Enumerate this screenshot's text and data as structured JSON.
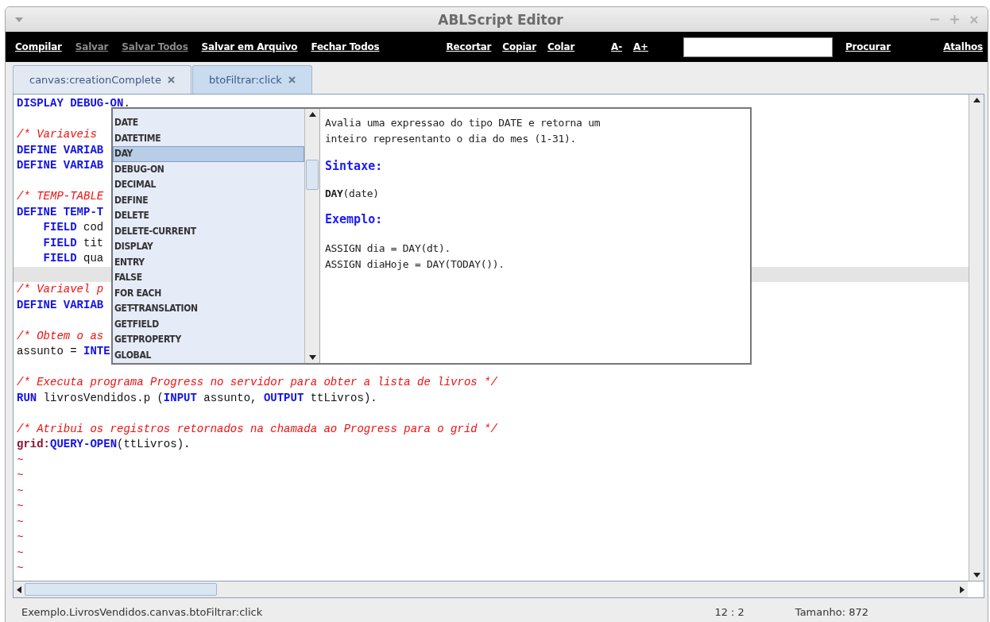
{
  "window": {
    "title": "ABLScript Editor"
  },
  "toolbar": {
    "groups": [
      [
        {
          "label": "Compilar",
          "disabled": false
        },
        {
          "label": "Salvar",
          "disabled": true
        },
        {
          "label": "Salvar Todos",
          "disabled": true
        },
        {
          "label": "Salvar em Arquivo",
          "disabled": false
        },
        {
          "label": "Fechar Todos",
          "disabled": false
        }
      ],
      [
        {
          "label": "Recortar",
          "disabled": false
        },
        {
          "label": "Copiar",
          "disabled": false
        },
        {
          "label": "Colar",
          "disabled": false
        }
      ],
      [
        {
          "label": "A-",
          "disabled": false
        },
        {
          "label": "A+",
          "disabled": false
        }
      ]
    ],
    "search_button": "Procurar",
    "shortcuts_button": "Atalhos"
  },
  "tabs": [
    {
      "label": "canvas:creationComplete",
      "selected": false
    },
    {
      "label": "btoFiltrar:click",
      "selected": true
    }
  ],
  "editor": {
    "lines": [
      {
        "current": false,
        "tokens": [
          {
            "kind": "keyword",
            "text": "DISPLAY DEBUG-ON"
          },
          {
            "kind": "plain",
            "text": "."
          }
        ]
      },
      {
        "current": false
      },
      {
        "current": false,
        "tokens": [
          {
            "kind": "comment",
            "text": "/* Variaveis"
          }
        ]
      },
      {
        "current": false,
        "tokens": [
          {
            "kind": "keyword",
            "text": "DEFINE VARIAB"
          }
        ]
      },
      {
        "current": false,
        "tokens": [
          {
            "kind": "keyword",
            "text": "DEFINE VARIAB"
          }
        ]
      },
      {
        "current": false
      },
      {
        "current": false,
        "tokens": [
          {
            "kind": "comment",
            "text": "/* TEMP-TABLE"
          }
        ]
      },
      {
        "current": false,
        "tokens": [
          {
            "kind": "keyword",
            "text": "DEFINE TEMP-T"
          }
        ]
      },
      {
        "current": false,
        "indented": true,
        "tokens": [
          {
            "kind": "keyword",
            "text": "FIELD"
          },
          {
            "kind": "plain",
            "text": " cod"
          }
        ]
      },
      {
        "current": false,
        "indented": true,
        "tokens": [
          {
            "kind": "keyword",
            "text": "FIELD"
          },
          {
            "kind": "plain",
            "text": " tit"
          }
        ]
      },
      {
        "current": false,
        "indented": true,
        "tokens": [
          {
            "kind": "keyword",
            "text": "FIELD"
          },
          {
            "kind": "plain",
            "text": " qua"
          }
        ]
      },
      {
        "current": true
      },
      {
        "current": false,
        "tokens": [
          {
            "kind": "comment",
            "text": "/* Variavel p"
          }
        ]
      },
      {
        "current": false,
        "tokens": [
          {
            "kind": "keyword",
            "text": "DEFINE VARIAB"
          }
        ]
      },
      {
        "current": false
      },
      {
        "current": false,
        "tokens": [
          {
            "kind": "comment",
            "text": "/* Obtem o as"
          }
        ]
      },
      {
        "current": false,
        "tokens": [
          {
            "kind": "plain",
            "text": "assunto = "
          },
          {
            "kind": "keyword",
            "text": "INTE"
          }
        ]
      },
      {
        "current": false
      },
      {
        "current": false,
        "tokens": [
          {
            "kind": "comment",
            "text": "/* Executa programa Progress no servidor para obter a lista de livros */"
          }
        ]
      },
      {
        "current": false,
        "tokens": [
          {
            "kind": "keyword",
            "text": "RUN"
          },
          {
            "kind": "plain",
            "text": " livrosVendidos.p ("
          },
          {
            "kind": "keyword",
            "text": "INPUT"
          },
          {
            "kind": "plain",
            "text": " assunto, "
          },
          {
            "kind": "keyword",
            "text": "OUTPUT"
          },
          {
            "kind": "plain",
            "text": " ttLivros)."
          }
        ]
      },
      {
        "current": false
      },
      {
        "current": false,
        "tokens": [
          {
            "kind": "comment",
            "text": "/* Atribui os registros retornados na chamada ao Progress para o grid */"
          }
        ]
      },
      {
        "current": false,
        "tokens": [
          {
            "kind": "object",
            "text": "grid:"
          },
          {
            "kind": "keyword",
            "text": "QUERY-OPEN"
          },
          {
            "kind": "plain",
            "text": "(ttLivros)."
          }
        ]
      },
      {
        "current": false,
        "tokens": [
          {
            "kind": "tilde",
            "text": "~"
          }
        ]
      },
      {
        "current": false,
        "tokens": [
          {
            "kind": "tilde",
            "text": "~"
          }
        ]
      },
      {
        "current": false,
        "tokens": [
          {
            "kind": "tilde",
            "text": "~"
          }
        ]
      },
      {
        "current": false,
        "tokens": [
          {
            "kind": "tilde",
            "text": "~"
          }
        ]
      },
      {
        "current": false,
        "tokens": [
          {
            "kind": "tilde",
            "text": "~"
          }
        ]
      },
      {
        "current": false,
        "tokens": [
          {
            "kind": "tilde",
            "text": "~"
          }
        ]
      },
      {
        "current": false,
        "tokens": [
          {
            "kind": "tilde",
            "text": "~"
          }
        ]
      },
      {
        "current": false,
        "tokens": [
          {
            "kind": "tilde",
            "text": "~"
          }
        ]
      }
    ]
  },
  "completion": {
    "items": [
      {
        "label": "DATE",
        "selected": false
      },
      {
        "label": "DATETIME",
        "selected": false
      },
      {
        "label": "DAY",
        "selected": true
      },
      {
        "label": "DEBUG-ON",
        "selected": false
      },
      {
        "label": "DECIMAL",
        "selected": false
      },
      {
        "label": "DEFINE",
        "selected": false
      },
      {
        "label": "DELETE",
        "selected": false
      },
      {
        "label": "DELETE-CURRENT",
        "selected": false
      },
      {
        "label": "DISPLAY",
        "selected": false
      },
      {
        "label": "ENTRY",
        "selected": false
      },
      {
        "label": "FALSE",
        "selected": false
      },
      {
        "label": "FOR EACH",
        "selected": false
      },
      {
        "label": "GET-TRANSLATION",
        "selected": false
      },
      {
        "label": "GETFIELD",
        "selected": false
      },
      {
        "label": "GETPROPERTY",
        "selected": false
      },
      {
        "label": "GLOBAL",
        "selected": false
      }
    ],
    "doc": {
      "description": "Avalia uma expressao do tipo DATE e retorna um\ninteiro representanto o dia do mes (1-31).",
      "syntax_heading": "Sintaxe:",
      "syntax": "**DAY**(date)",
      "example_heading": "Exemplo:",
      "example": [
        "ASSIGN dia = DAY(dt).",
        "ASSIGN diaHoje = DAY(TODAY())."
      ]
    }
  },
  "status_bar": {
    "path": "Exemplo.LivrosVendidos.canvas.btoFiltrar:click",
    "position": "12 : 2",
    "size": "Tamanho: 872"
  }
}
